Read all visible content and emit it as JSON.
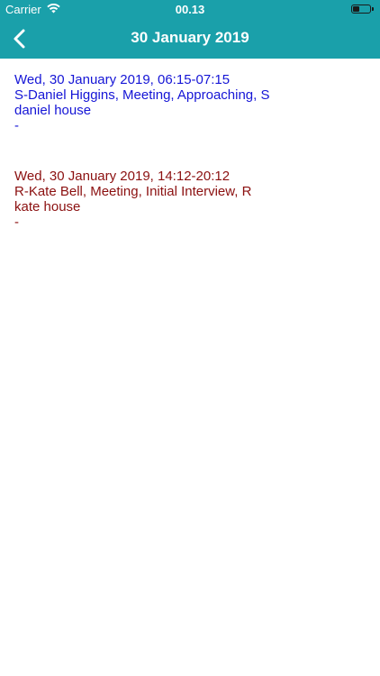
{
  "status_bar": {
    "carrier": "Carrier",
    "time": "00.13",
    "wifi_icon": "wifi-icon",
    "battery_icon": "battery-icon",
    "battery_level": 0.4
  },
  "nav": {
    "back_icon": "chevron-left-icon",
    "title": "30 January 2019",
    "color": "#1aa0aa"
  },
  "entries": [
    {
      "date": "Wed, 30 January 2019, 06:15-07:15",
      "line1": "S-Daniel Higgins, Meeting, Approaching, S",
      "line2": "daniel house",
      "line3": "-",
      "color": "#1515d6"
    },
    {
      "date": "Wed, 30 January 2019, 14:12-20:12",
      "line1": "R-Kate Bell, Meeting, Initial Interview, R",
      "line2": "kate house",
      "line3": "-",
      "color": "#8b1010"
    }
  ]
}
